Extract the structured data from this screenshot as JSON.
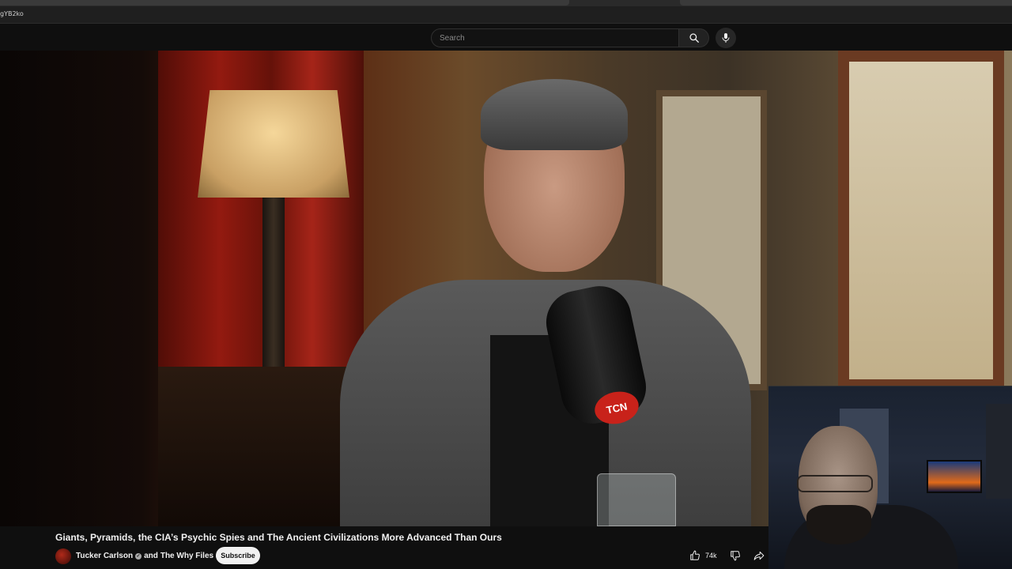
{
  "browser": {
    "url_fragment": "gYB2ko"
  },
  "header": {
    "search_placeholder": "Search",
    "search_icon": "search-icon",
    "mic_icon": "microphone-icon"
  },
  "video": {
    "mic_badge_text": "TCN"
  },
  "info": {
    "title": "Giants, Pyramids, the CIA’s Psychic Spies and The Ancient Civilizations More Advanced Than Ours",
    "channel_primary": "Tucker Carlson",
    "channel_joiner": "and",
    "channel_secondary": "The Why Files",
    "verified_icon": "verified-check-icon",
    "subscribe_label": "Subscribe",
    "like_count": "74k",
    "like_icon": "thumbs-up-icon",
    "dislike_icon": "thumbs-down-icon",
    "share_icon": "share-icon"
  },
  "colors": {
    "background": "#0f0f0f",
    "text": "#f1f1f1",
    "subscribe_bg": "#f1f1f1",
    "mic_badge": "#c8221a"
  }
}
